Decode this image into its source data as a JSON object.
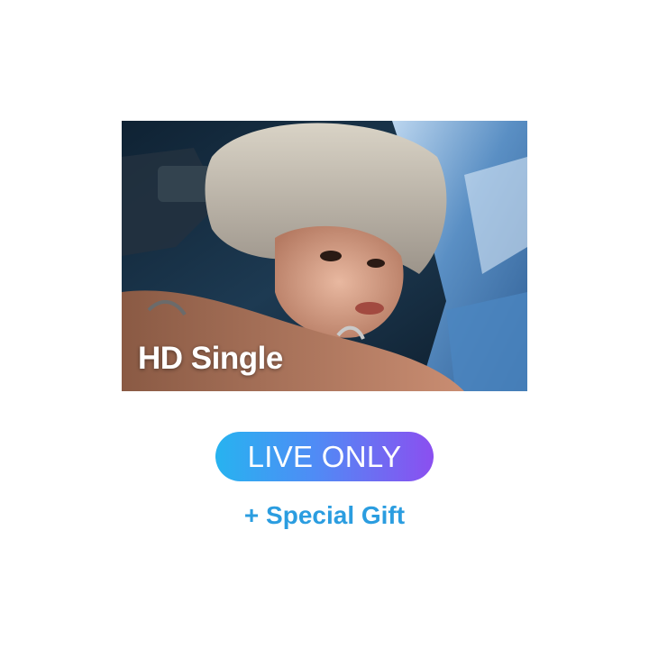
{
  "product": {
    "photo_caption": "HD Single",
    "photo_subject": "portrait photo of a blond-haired person resting head on arms, wearing a shiny blue jacket",
    "badge_label": "LIVE ONLY",
    "gift_label": "+ Special Gift"
  },
  "colors": {
    "badge_gradient_start": "#27b3f0",
    "badge_gradient_end": "#8b4ff0",
    "gift_text": "#2b9de0",
    "background": "#ffffff"
  }
}
